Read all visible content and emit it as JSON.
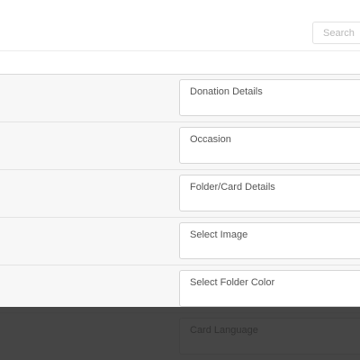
{
  "search": {
    "placeholder": "Search"
  },
  "rows": [
    {
      "label": "Donation Details"
    },
    {
      "label": "Occasion"
    },
    {
      "label": "Folder/Card Details"
    },
    {
      "label": "Select Image"
    },
    {
      "label": "Select Folder Color"
    },
    {
      "label": "Card Language"
    }
  ]
}
